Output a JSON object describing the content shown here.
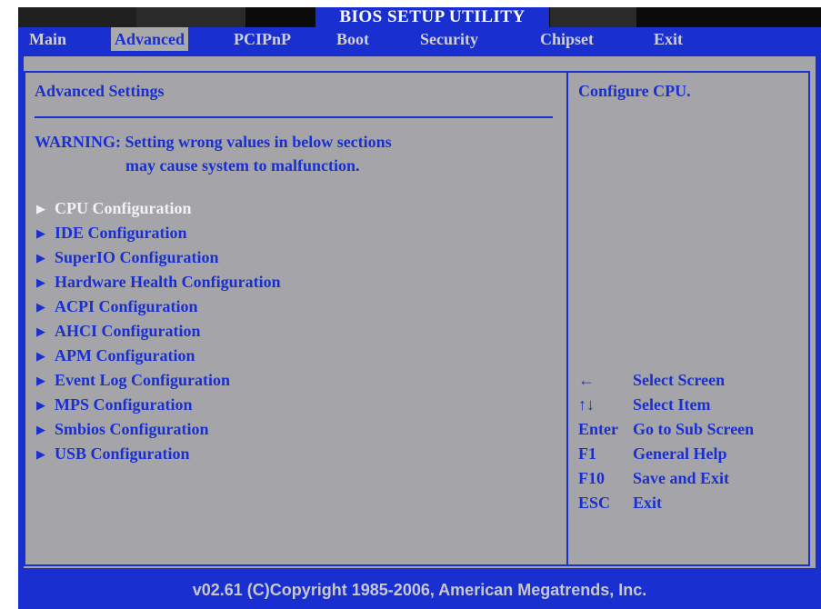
{
  "title": "BIOS SETUP UTILITY",
  "menu": [
    {
      "label": "Main",
      "active": false
    },
    {
      "label": "Advanced",
      "active": true
    },
    {
      "label": "PCIPnP",
      "active": false
    },
    {
      "label": "Boot",
      "active": false
    },
    {
      "label": "Security",
      "active": false
    },
    {
      "label": "Chipset",
      "active": false
    },
    {
      "label": "Exit",
      "active": false
    }
  ],
  "panel": {
    "heading": "Advanced Settings",
    "warning_line1": "WARNING: Setting wrong values in below sections",
    "warning_line2": "may cause system to malfunction.",
    "items": [
      {
        "label": "CPU Configuration",
        "selected": true
      },
      {
        "label": "IDE Configuration",
        "selected": false
      },
      {
        "label": "SuperIO Configuration",
        "selected": false
      },
      {
        "label": "Hardware Health Configuration",
        "selected": false
      },
      {
        "label": "ACPI Configuration",
        "selected": false
      },
      {
        "label": "AHCI Configuration",
        "selected": false
      },
      {
        "label": "APM Configuration",
        "selected": false
      },
      {
        "label": "Event Log Configuration",
        "selected": false
      },
      {
        "label": "MPS Configuration",
        "selected": false
      },
      {
        "label": "Smbios Configuration",
        "selected": false
      },
      {
        "label": "USB Configuration",
        "selected": false
      }
    ]
  },
  "help": {
    "description": "Configure CPU.",
    "keys": [
      {
        "key": "←",
        "action": "Select Screen"
      },
      {
        "key": "↑↓",
        "action": "Select Item"
      },
      {
        "key": "Enter",
        "action": "Go to Sub Screen"
      },
      {
        "key": "F1",
        "action": "General Help"
      },
      {
        "key": "F10",
        "action": "Save and Exit"
      },
      {
        "key": "ESC",
        "action": "Exit"
      }
    ]
  },
  "footer": "v02.61 (C)Copyright 1985-2006, American Megatrends, Inc.",
  "colors": {
    "blue": "#1a2fd0",
    "panel_gray": "#a5a5a9",
    "selected_text": "#f2f2f2"
  }
}
